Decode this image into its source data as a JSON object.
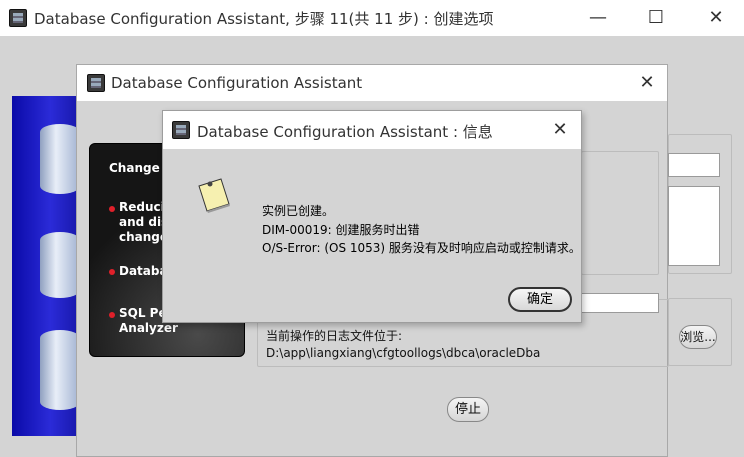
{
  "main_window": {
    "title": "Database Configuration Assistant, 步骤 11(共 11 步) : 创建选项",
    "minimize_glyph": "—",
    "maximize_glyph": "☐",
    "close_glyph": "✕"
  },
  "progress_dialog": {
    "title": "Database Configuration Assistant",
    "close_glyph": "✕",
    "image_text": {
      "heading": "Change A",
      "bullet1_line1": "Reducin",
      "bullet1_line2": "and dis",
      "bullet1_line3": "change",
      "bullet2": "Databa",
      "bullet3_line1": "SQL Pe",
      "bullet3_line2": "Analyzer"
    },
    "browse_label": "浏览...",
    "log_label": "当前操作的日志文件位于:",
    "log_path": "D:\\app\\liangxiang\\cfgtoollogs\\dbca\\oracleDba",
    "stop_label": "停止"
  },
  "info_dialog": {
    "title": "Database Configuration Assistant : 信息",
    "close_glyph": "✕",
    "line1": "实例已创建。",
    "line2": "DIM-00019: 创建服务时出错",
    "line3": "O/S-Error: (OS 1053) 服务没有及时响应启动或控制请求。",
    "ok_label": "确定"
  }
}
